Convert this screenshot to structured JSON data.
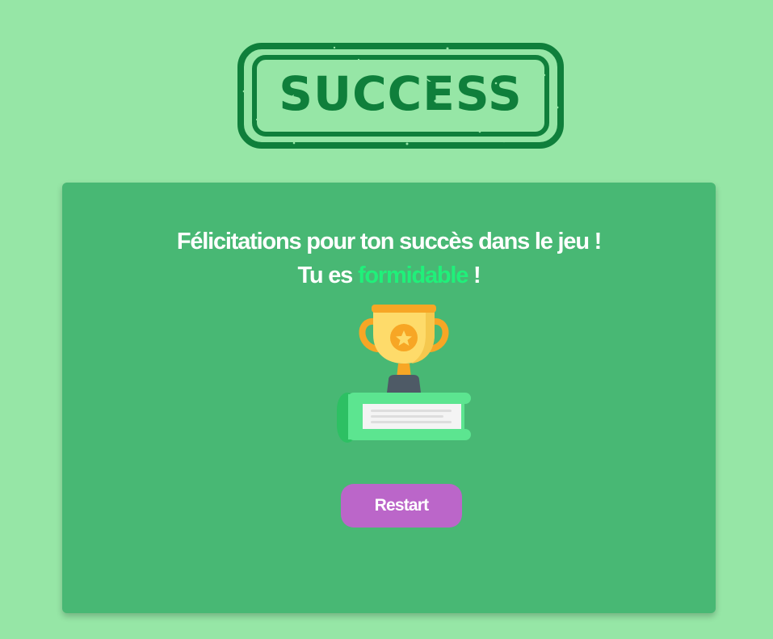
{
  "stamp": {
    "text": "SUCCESS",
    "color": "#0f7f3b"
  },
  "message": {
    "line1": "Félicitations pour ton succès dans le jeu !",
    "line2_prefix": "Tu es",
    "highlight": "formidable",
    "line2_suffix": "!"
  },
  "illustration": {
    "icon": "trophy-on-book-icon"
  },
  "actions": {
    "restart_label": "Restart"
  },
  "colors": {
    "page_background": "#96e6a6",
    "card_background": "#48b874",
    "highlight_text": "#20f07a",
    "button_background": "#bb66c9",
    "trophy_gold": "#fedb6a",
    "trophy_orange": "#f7a625",
    "book_green": "#5ce590"
  }
}
